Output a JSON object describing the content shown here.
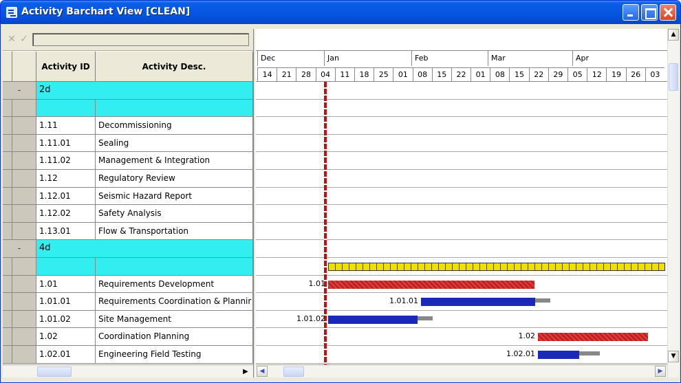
{
  "window": {
    "title": "Activity Barchart View [CLEAN]",
    "titlebar_color": "#0554e1"
  },
  "editbar": {
    "cancel_icon": "✕",
    "accept_icon": "✓",
    "value": ""
  },
  "grid": {
    "headers": {
      "activity_id": "Activity ID",
      "activity_desc": "Activity Desc."
    },
    "rows": [
      {
        "type": "group",
        "toggle": "-",
        "label": "2d"
      },
      {
        "type": "groupsub",
        "id": "",
        "desc": ""
      },
      {
        "type": "activity",
        "id": "1.11",
        "desc": "Decommissioning"
      },
      {
        "type": "activity",
        "id": "1.11.01",
        "desc": "Sealing"
      },
      {
        "type": "activity",
        "id": "1.11.02",
        "desc": "Management & Integration"
      },
      {
        "type": "activity",
        "id": "1.12",
        "desc": "Regulatory Review"
      },
      {
        "type": "activity",
        "id": "1.12.01",
        "desc": "Seismic Hazard Report"
      },
      {
        "type": "activity",
        "id": "1.12.02",
        "desc": "Safety Analysis"
      },
      {
        "type": "activity",
        "id": "1.13.01",
        "desc": "Flow & Transportation"
      },
      {
        "type": "group",
        "toggle": "-",
        "label": "4d"
      },
      {
        "type": "groupsub",
        "id": "",
        "desc": ""
      },
      {
        "type": "activity",
        "id": "1.01",
        "desc": "Requirements Development"
      },
      {
        "type": "activity",
        "id": "1.01.01",
        "desc": "Requirements Coordination & Plannir"
      },
      {
        "type": "activity",
        "id": "1.01.02",
        "desc": "Site Management"
      },
      {
        "type": "activity",
        "id": "1.02",
        "desc": "Coordination Planning"
      },
      {
        "type": "activity",
        "id": "1.02.01",
        "desc": "Engineering Field Testing"
      }
    ],
    "group_color": "#33eef0"
  },
  "timeline": {
    "months": [
      "Dec",
      "Jan",
      "Feb",
      "Mar",
      "Apr"
    ],
    "days": [
      "14",
      "21",
      "28",
      "04",
      "11",
      "18",
      "25",
      "01",
      "08",
      "15",
      "22",
      "01",
      "08",
      "15",
      "22",
      "29",
      "05",
      "12",
      "19",
      "26",
      "03"
    ]
  },
  "bars": [
    {
      "row": 10,
      "label": "",
      "color": "#f0e000",
      "style": "summary"
    },
    {
      "row": 11,
      "label": "1.01",
      "color": "#c02020",
      "style": "critical"
    },
    {
      "row": 12,
      "label": "1.01.01",
      "color": "#1a2ab8",
      "style": "normal"
    },
    {
      "row": 13,
      "label": "1.01.02",
      "color": "#1a2ab8",
      "style": "normal"
    },
    {
      "row": 14,
      "label": "1.02",
      "color": "#c02020",
      "style": "critical"
    },
    {
      "row": 15,
      "label": "1.02.01",
      "color": "#1a2ab8",
      "style": "normal"
    }
  ],
  "today_line_color": "#c01010"
}
